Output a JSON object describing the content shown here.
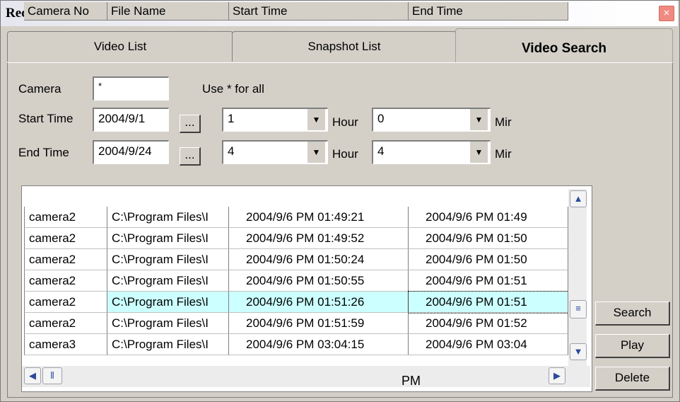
{
  "window": {
    "title": "Record List",
    "close_glyph": "×"
  },
  "tabs": [
    {
      "label": "Video List"
    },
    {
      "label": "Snapshot List"
    },
    {
      "label": "Video Search"
    }
  ],
  "form": {
    "camera_label": "Camera",
    "camera_value": "*",
    "camera_hint": "Use * for all",
    "start_label": "Start Time",
    "start_date": "2004/9/1",
    "start_hour": "1",
    "start_min": "0",
    "end_label": "End Time",
    "end_date": "2004/9/24",
    "end_hour": "4",
    "end_min": "4",
    "hour_label": "Hour",
    "min_label": "Mir",
    "browse_label": "..."
  },
  "grid": {
    "columns": [
      "Camera No",
      "File Name",
      "Start Time",
      "End Time"
    ],
    "rows": [
      {
        "camera": "camera2",
        "file": "C:\\Program Files\\I",
        "start": "2004/9/6  PM 01:49:21",
        "end": "2004/9/6  PM 01:49"
      },
      {
        "camera": "camera2",
        "file": "C:\\Program Files\\I",
        "start": "2004/9/6  PM 01:49:52",
        "end": "2004/9/6  PM 01:50"
      },
      {
        "camera": "camera2",
        "file": "C:\\Program Files\\I",
        "start": "2004/9/6  PM 01:50:24",
        "end": "2004/9/6  PM 01:50"
      },
      {
        "camera": "camera2",
        "file": "C:\\Program Files\\I",
        "start": "2004/9/6  PM 01:50:55",
        "end": "2004/9/6  PM 01:51"
      },
      {
        "camera": "camera2",
        "file": "C:\\Program Files\\I",
        "start": "2004/9/6  PM 01:51:26",
        "end": "2004/9/6  PM 01:51"
      },
      {
        "camera": "camera2",
        "file": "C:\\Program Files\\I",
        "start": "2004/9/6  PM 01:51:59",
        "end": "2004/9/6  PM 01:52"
      },
      {
        "camera": "camera3",
        "file": "C:\\Program Files\\I",
        "start": "2004/9/6  PM 03:04:15",
        "end": "2004/9/6  PM 03:04"
      }
    ],
    "selected_row": 4,
    "footer_text": "PM"
  },
  "buttons": {
    "search": "Search",
    "play": "Play",
    "delete": "Delete"
  }
}
